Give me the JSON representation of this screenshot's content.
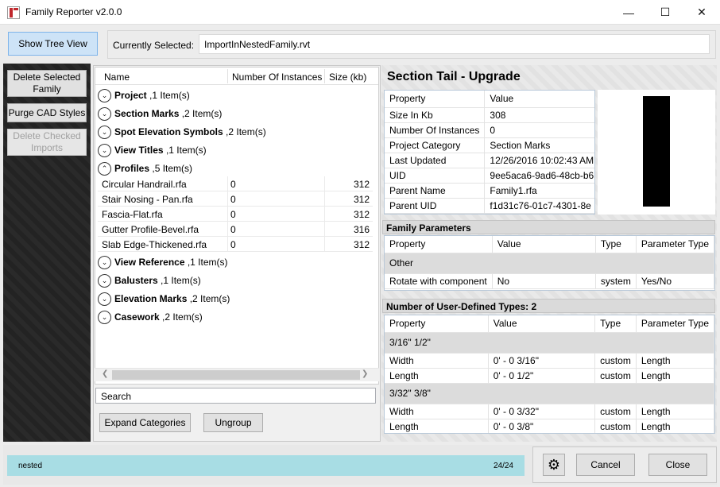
{
  "window": {
    "title": "Family Reporter v2.0.0",
    "minimize_glyph": "—",
    "maximize_glyph": "☐",
    "close_glyph": "✕"
  },
  "topbar": {
    "show_tree_label": "Show Tree View",
    "current_label": "Currently Selected:",
    "current_value": "ImportInNestedFamily.rvt"
  },
  "sidebar": {
    "delete_selected": "Delete Selected Family",
    "purge_cad": "Purge CAD Styles",
    "delete_checked": "Delete Checked Imports"
  },
  "tree": {
    "headers": [
      "Name",
      "Number Of Instances",
      "Size (kb)"
    ],
    "categories": [
      {
        "name": "Project",
        "count": ",1 Item(s)",
        "expanded": false
      },
      {
        "name": "Section Marks",
        "count": ",2 Item(s)",
        "expanded": false
      },
      {
        "name": "Spot Elevation Symbols",
        "count": ",2 Item(s)",
        "expanded": false
      },
      {
        "name": "View Titles",
        "count": ",1 Item(s)",
        "expanded": false
      },
      {
        "name": "Profiles",
        "count": ",5 Item(s)",
        "expanded": true
      },
      {
        "name": "View Reference",
        "count": ",1 Item(s)",
        "expanded": false
      },
      {
        "name": "Balusters",
        "count": ",1 Item(s)",
        "expanded": false
      },
      {
        "name": "Elevation Marks",
        "count": ",2 Item(s)",
        "expanded": false
      },
      {
        "name": "Casework",
        "count": ",2 Item(s)",
        "expanded": false
      }
    ],
    "profile_items": [
      {
        "name": "Circular Handrail.rfa",
        "instances": "0",
        "size": "312"
      },
      {
        "name": "Stair Nosing - Pan.rfa",
        "instances": "0",
        "size": "312"
      },
      {
        "name": "Fascia-Flat.rfa",
        "instances": "0",
        "size": "312"
      },
      {
        "name": "Gutter Profile-Bevel.rfa",
        "instances": "0",
        "size": "316"
      },
      {
        "name": "Slab Edge-Thickened.rfa",
        "instances": "0",
        "size": "312"
      }
    ],
    "search_placeholder": "Search",
    "expand_label": "Expand Categories",
    "ungroup_label": "Ungroup"
  },
  "details": {
    "title": "Section Tail - Upgrade",
    "prop_headers": [
      "Property",
      "Value"
    ],
    "properties": [
      {
        "p": "Size In Kb",
        "v": "308"
      },
      {
        "p": "Number Of Instances",
        "v": "0"
      },
      {
        "p": "Project Category",
        "v": "Section Marks"
      },
      {
        "p": "Last Updated",
        "v": "12/26/2016 10:02:43 AM"
      },
      {
        "p": "UID",
        "v": "9ee5aca6-9ad6-48cb-b6"
      },
      {
        "p": "Parent Name",
        "v": "Family1.rfa"
      },
      {
        "p": "Parent UID",
        "v": "f1d31c76-01c7-4301-8e"
      }
    ]
  },
  "family_params": {
    "header": "Family Parameters",
    "columns": [
      "Property",
      "Value",
      "Type",
      "Parameter Type"
    ],
    "group": "Other",
    "rows": [
      {
        "p": "Rotate with component",
        "v": "No",
        "t": "system",
        "pt": "Yes/No"
      }
    ]
  },
  "types": {
    "header": "Number of User-Defined Types:  2",
    "columns": [
      "Property",
      "Value",
      "Type",
      "Parameter Type"
    ],
    "groups": [
      {
        "name": "3/16\" 1/2\"",
        "rows": [
          {
            "p": "Width",
            "v": "0' - 0 3/16\"",
            "t": "custom",
            "pt": "Length"
          },
          {
            "p": "Length",
            "v": "0' - 0 1/2\"",
            "t": "custom",
            "pt": "Length"
          }
        ]
      },
      {
        "name": "3/32\" 3/8\"",
        "rows": [
          {
            "p": "Width",
            "v": "0' - 0 3/32\"",
            "t": "custom",
            "pt": "Length"
          },
          {
            "p": "Length",
            "v": "0' - 0 3/8\"",
            "t": "custom",
            "pt": "Length"
          }
        ]
      }
    ]
  },
  "status": {
    "left_text": "nested",
    "right_text": "24/24",
    "cancel_label": "Cancel",
    "close_label": "Close"
  }
}
